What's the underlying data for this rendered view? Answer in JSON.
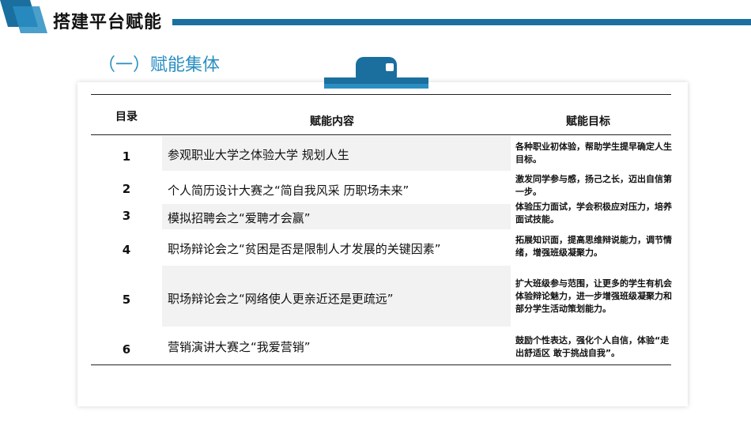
{
  "header": {
    "title": "搭建平台赋能",
    "subtitle": "（一）赋能集体"
  },
  "colors": {
    "accent_dark": "#1a6f9e",
    "accent_light": "#2a8ec2"
  },
  "table": {
    "headers": {
      "index": "目录",
      "content": "赋能内容",
      "goal": "赋能目标"
    },
    "rows": [
      {
        "index": "1",
        "content": "参观职业大学之体验大学 规划人生",
        "goal": "各种职业初体验，帮助学生提早确定人生目标。"
      },
      {
        "index": "2",
        "content": "个人简历设计大赛之“简自我风采 历职场未来”",
        "goal": "激发同学参与感，扬己之长，迈出自信第一步。"
      },
      {
        "index": "3",
        "content": "模拟招聘会之“爱聘才会赢”",
        "goal": "体验压力面试，学会积极应对压力，培养面试技能。"
      },
      {
        "index": "4",
        "content": "职场辩论会之“贫困是否是限制人才发展的关键因素”",
        "goal": "拓展知识面，提高思维辩说能力，调节情绪，增强班级凝聚力。"
      },
      {
        "index": "5",
        "content": "职场辩论会之“网络使人更亲近还是更疏远”",
        "goal": "扩大班级参与范围，让更多的学生有机会体验辩论魅力，进一步增强班级凝聚力和部分学生活动策划能力。"
      },
      {
        "index": "6",
        "content": "营销演讲大赛之“我爱营销”",
        "goal": "鼓励个性表达，强化个人自信，体验“走出舒适区 敢于挑战自我”。"
      }
    ]
  }
}
